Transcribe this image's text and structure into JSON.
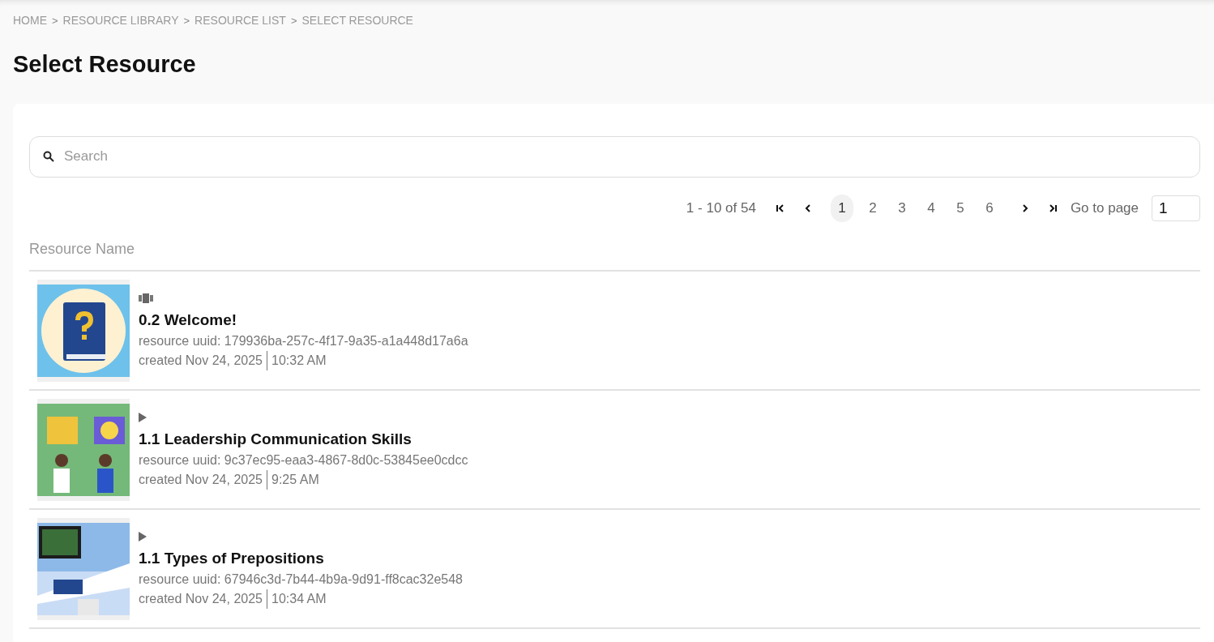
{
  "breadcrumb": [
    {
      "kind": "link",
      "text": "HOME"
    },
    {
      "kind": "separator",
      "text": ">"
    },
    {
      "kind": "link",
      "text": "RESOURCE LIBRARY"
    },
    {
      "kind": "separator",
      "text": ">"
    },
    {
      "kind": "link",
      "text": "RESOURCE LIST"
    },
    {
      "kind": "separator",
      "text": ">"
    },
    {
      "kind": "link",
      "text": "SELECT RESOURCE"
    }
  ],
  "title": "Select Resource",
  "search": {
    "placeholder": "Search"
  },
  "pagination": {
    "range": "1 - 10 of 54",
    "pages": [
      {
        "label": "1",
        "selected": true
      },
      {
        "label": "2",
        "selected": false
      },
      {
        "label": "3",
        "selected": false
      },
      {
        "label": "4",
        "selected": false
      },
      {
        "label": "5",
        "selected": false
      },
      {
        "label": "6",
        "selected": false
      }
    ],
    "goto_label": "Go to page",
    "goto_value": "1"
  },
  "table": {
    "columns": [
      "Resource Name"
    ],
    "rows": [
      {
        "kind": "slides",
        "thumbnail": {
          "kind": "book"
        },
        "name": "0.2 Welcome!",
        "uuid": "resource uuid: 179936ba-257c-4f17-9a35-a1a448d17a6a",
        "created": "created Nov 24, 2025",
        "time": "10:32 AM"
      },
      {
        "kind": "video",
        "thumbnail": {
          "kind": "people"
        },
        "name": "1.1 Leadership Communication Skills",
        "uuid": "resource uuid: 9c37ec95-eaa3-4867-8d0c-53845ee0cdcc",
        "created": "created Nov 24, 2025",
        "time": "9:25 AM"
      },
      {
        "kind": "video",
        "thumbnail": {
          "kind": "desk"
        },
        "name": "1.1 Types of Prepositions",
        "uuid": "resource uuid: 67946c3d-7b44-4b9a-9d91-ff8cac32e548",
        "created": "created Nov 24, 2025",
        "time": "10:34 AM"
      }
    ]
  }
}
